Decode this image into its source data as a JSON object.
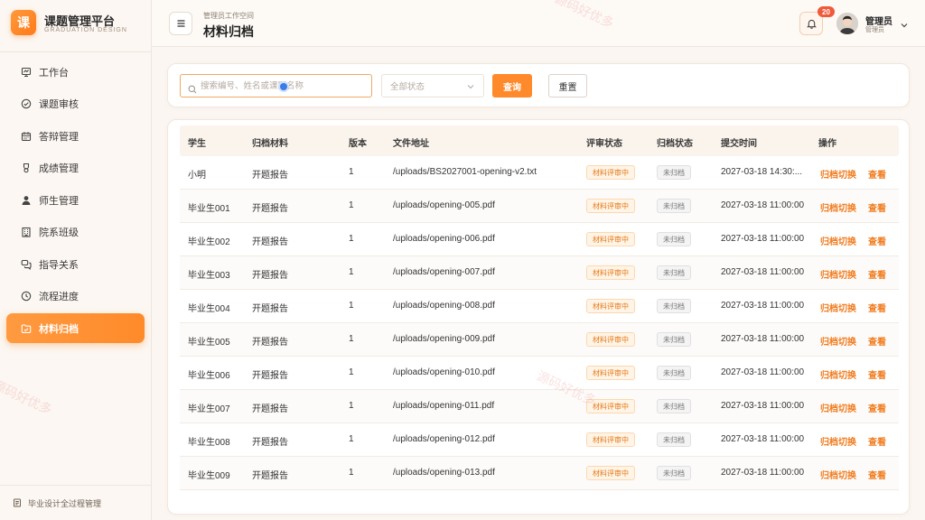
{
  "brand": {
    "logo": "课",
    "title": "课题管理平台",
    "subtitle": "GRADUATION DESIGN"
  },
  "sidebar": {
    "items": [
      {
        "label": "工作台",
        "icon": "workbench-icon",
        "active": false
      },
      {
        "label": "课题审核",
        "icon": "check-circle-icon",
        "active": false
      },
      {
        "label": "答辩管理",
        "icon": "calendar-icon",
        "active": false
      },
      {
        "label": "成绩管理",
        "icon": "medal-icon",
        "active": false
      },
      {
        "label": "师生管理",
        "icon": "user-icon",
        "active": false
      },
      {
        "label": "院系班级",
        "icon": "building-icon",
        "active": false
      },
      {
        "label": "指导关系",
        "icon": "chat-icon",
        "active": false
      },
      {
        "label": "流程进度",
        "icon": "clock-icon",
        "active": false
      },
      {
        "label": "材料归档",
        "icon": "folder-icon",
        "active": true
      }
    ],
    "footer": "毕业设计全过程管理"
  },
  "header": {
    "breadcrumb": "管理员工作空间",
    "title": "材料归档",
    "notification_count": "20",
    "user_name": "管理员",
    "user_role": "管理员"
  },
  "search": {
    "placeholder": "搜索编号、姓名或课题名称",
    "value": "",
    "status_placeholder": "全部状态",
    "query_label": "查询",
    "reset_label": "重置"
  },
  "table": {
    "columns": [
      "学生",
      "归档材料",
      "版本",
      "文件地址",
      "评审状态",
      "归档状态",
      "提交时间",
      "操作"
    ],
    "rows": [
      {
        "student": "小明",
        "material": "开题报告",
        "version": "1",
        "path": "/uploads/BS2027001-opening-v2.txt",
        "review": "材料评审中",
        "archive": "未归档",
        "time": "2027-03-18 14:30:..."
      },
      {
        "student": "毕业生001",
        "material": "开题报告",
        "version": "1",
        "path": "/uploads/opening-005.pdf",
        "review": "材料评审中",
        "archive": "未归档",
        "time": "2027-03-18 11:00:00"
      },
      {
        "student": "毕业生002",
        "material": "开题报告",
        "version": "1",
        "path": "/uploads/opening-006.pdf",
        "review": "材料评审中",
        "archive": "未归档",
        "time": "2027-03-18 11:00:00"
      },
      {
        "student": "毕业生003",
        "material": "开题报告",
        "version": "1",
        "path": "/uploads/opening-007.pdf",
        "review": "材料评审中",
        "archive": "未归档",
        "time": "2027-03-18 11:00:00"
      },
      {
        "student": "毕业生004",
        "material": "开题报告",
        "version": "1",
        "path": "/uploads/opening-008.pdf",
        "review": "材料评审中",
        "archive": "未归档",
        "time": "2027-03-18 11:00:00"
      },
      {
        "student": "毕业生005",
        "material": "开题报告",
        "version": "1",
        "path": "/uploads/opening-009.pdf",
        "review": "材料评审中",
        "archive": "未归档",
        "time": "2027-03-18 11:00:00"
      },
      {
        "student": "毕业生006",
        "material": "开题报告",
        "version": "1",
        "path": "/uploads/opening-010.pdf",
        "review": "材料评审中",
        "archive": "未归档",
        "time": "2027-03-18 11:00:00"
      },
      {
        "student": "毕业生007",
        "material": "开题报告",
        "version": "1",
        "path": "/uploads/opening-011.pdf",
        "review": "材料评审中",
        "archive": "未归档",
        "time": "2027-03-18 11:00:00"
      },
      {
        "student": "毕业生008",
        "material": "开题报告",
        "version": "1",
        "path": "/uploads/opening-012.pdf",
        "review": "材料评审中",
        "archive": "未归档",
        "time": "2027-03-18 11:00:00"
      },
      {
        "student": "毕业生009",
        "material": "开题报告",
        "version": "1",
        "path": "/uploads/opening-013.pdf",
        "review": "材料评审中",
        "archive": "未归档",
        "time": "2027-03-18 11:00:00"
      }
    ],
    "action_archive": "归档切换",
    "action_view": "查看"
  },
  "watermark": "源码好优多",
  "colors": {
    "accent": "#ff8a2c",
    "badge": "#f05a3a",
    "review_tag": "#e47a1a"
  }
}
